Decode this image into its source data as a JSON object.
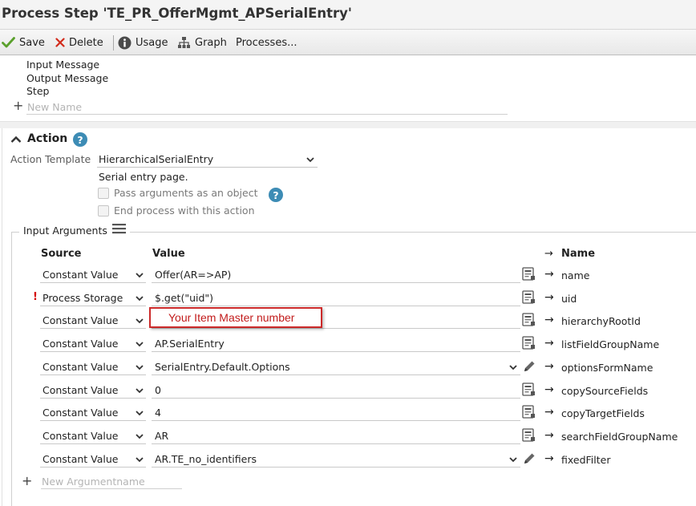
{
  "window": {
    "title": "Process Step 'TE_PR_OfferMgmt_APSerialEntry'"
  },
  "toolbar": {
    "save_label": "Save",
    "delete_label": "Delete",
    "usage_label": "Usage",
    "graph_label": "Graph",
    "processes_label": "Processes..."
  },
  "top_section": {
    "items": [
      "Input Message",
      "Output Message",
      "Step"
    ],
    "new_name_placeholder": "New Name"
  },
  "action": {
    "header": "Action",
    "help_icon": "?",
    "template_label": "Action Template",
    "template_value": "HierarchicalSerialEntry",
    "description": "Serial entry page.",
    "pass_args_label": "Pass arguments as an object",
    "end_process_label": "End process with this action",
    "pass_args_checked": false,
    "end_process_checked": false
  },
  "input_arguments": {
    "legend": "Input Arguments",
    "col_source": "Source",
    "col_value": "Value",
    "col_name": "Name",
    "rows": [
      {
        "source": "Constant Value",
        "value": "Offer(AR=>AP)",
        "name": "name",
        "warning": "",
        "value_type": "text"
      },
      {
        "source": "Process Storage",
        "value": "$.get(\"uid\")",
        "name": "uid",
        "warning": "!",
        "value_type": "text"
      },
      {
        "source": "Constant Value",
        "value": "",
        "name": "hierarchyRootId",
        "warning": "",
        "value_type": "text"
      },
      {
        "source": "Constant Value",
        "value": "AP.SerialEntry",
        "name": "listFieldGroupName",
        "warning": "",
        "value_type": "text"
      },
      {
        "source": "Constant Value",
        "value": "SerialEntry.Default.Options",
        "name": "optionsFormName",
        "warning": "",
        "value_type": "select"
      },
      {
        "source": "Constant Value",
        "value": "0",
        "name": "copySourceFields",
        "warning": "",
        "value_type": "text"
      },
      {
        "source": "Constant Value",
        "value": "4",
        "name": "copyTargetFields",
        "warning": "",
        "value_type": "text"
      },
      {
        "source": "Constant Value",
        "value": "AR",
        "name": "searchFieldGroupName",
        "warning": "",
        "value_type": "text"
      },
      {
        "source": "Constant Value",
        "value": "AR.TE_no_identifiers",
        "name": "fixedFilter",
        "warning": "",
        "value_type": "select"
      }
    ],
    "new_argument_placeholder": "New Argumentname"
  },
  "annotation": {
    "callout_text": "Your Item Master number",
    "color": "#cc2a2a"
  },
  "colors": {
    "accent": "#3d8cb5",
    "save_check": "#5aa02c",
    "delete_x": "#d22a1a"
  }
}
